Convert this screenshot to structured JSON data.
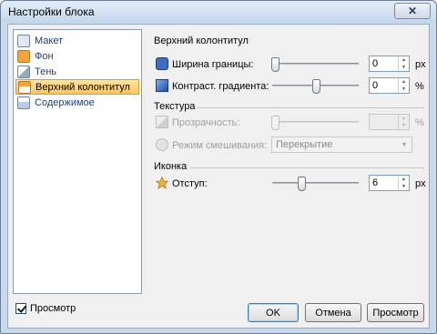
{
  "window": {
    "title": "Настройки блока",
    "close_icon": "close-icon"
  },
  "nav": {
    "items": [
      {
        "label": "Макет",
        "icon": "layout-icon",
        "color": "#dfe8f3"
      },
      {
        "label": "Фон",
        "icon": "background-icon",
        "color": "#f3a43a"
      },
      {
        "label": "Тень",
        "icon": "shadow-icon",
        "color": "#d4dbe6"
      },
      {
        "label": "Верхний колонтитул",
        "icon": "header-icon",
        "color": "#f3a43a"
      },
      {
        "label": "Содержимое",
        "icon": "content-icon",
        "color": "#dfe8f3"
      }
    ],
    "selected_index": 3
  },
  "preview_checkbox": {
    "label": "Просмотр",
    "checked": true
  },
  "section": {
    "title": "Верхний колонтитул",
    "border_width": {
      "label": "Ширина границы:",
      "value": "0",
      "unit": "px",
      "slider_fraction": 0.0
    },
    "gradient_contrast": {
      "label": "Контраст. градиента:",
      "value": "0",
      "unit": "%",
      "slider_fraction": 0.48
    }
  },
  "texture": {
    "group_label": "Текстура",
    "transparency": {
      "label": "Прозрачность:",
      "value": "",
      "unit": "%",
      "slider_fraction": 0.0,
      "enabled": false
    },
    "blend_mode": {
      "label": "Режим смешивания:",
      "value": "Перекрытие",
      "enabled": false
    }
  },
  "icon_group": {
    "group_label": "Иконка",
    "offset": {
      "label": "Отступ:",
      "value": "6",
      "unit": "px",
      "slider_fraction": 0.33
    }
  },
  "buttons": {
    "ok": "OK",
    "cancel": "Отмена",
    "preview": "Просмотр"
  }
}
